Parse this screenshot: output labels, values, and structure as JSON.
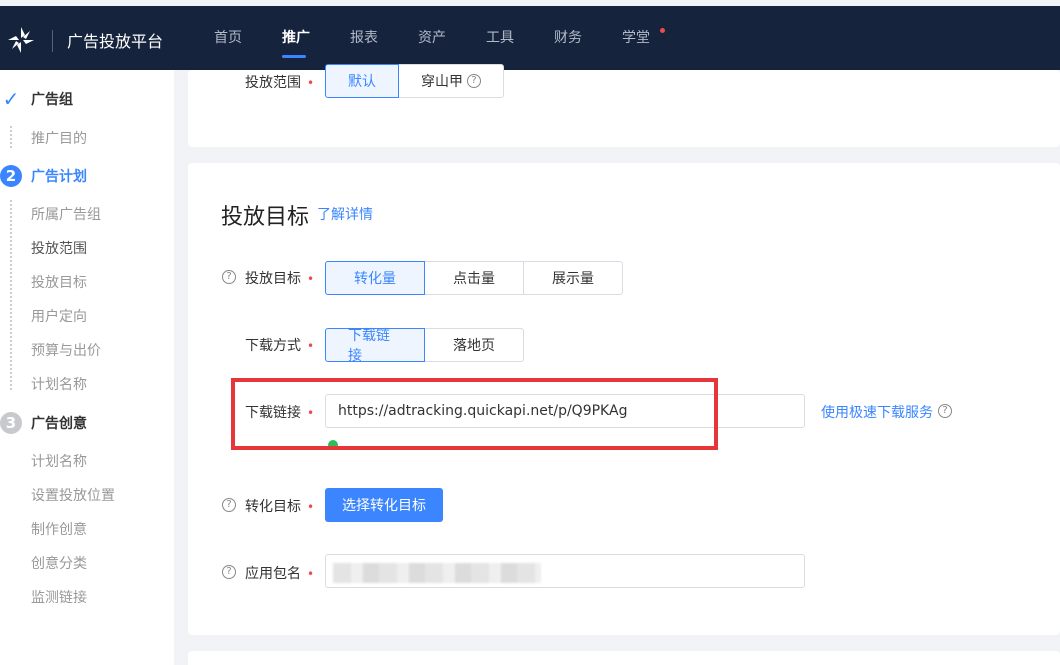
{
  "header": {
    "brand": "广告投放平台",
    "nav": [
      {
        "label": "首页",
        "active": false
      },
      {
        "label": "推广",
        "active": true
      },
      {
        "label": "报表",
        "active": false
      },
      {
        "label": "资产",
        "active": false
      },
      {
        "label": "工具",
        "active": false
      },
      {
        "label": "财务",
        "active": false
      },
      {
        "label": "学堂",
        "active": false,
        "dot": true
      }
    ]
  },
  "sidebar": {
    "steps": [
      {
        "icon": "check-icon",
        "marker": "✓",
        "label": "广告组",
        "state": "done",
        "items": [
          "推广目的"
        ]
      },
      {
        "marker": "2",
        "label": "广告计划",
        "state": "active",
        "items": [
          "所属广告组",
          "投放范围",
          "投放目标",
          "用户定向",
          "预算与出价",
          "计划名称"
        ]
      },
      {
        "marker": "3",
        "label": "广告创意",
        "state": "pending",
        "items": [
          "计划名称",
          "设置投放位置",
          "制作创意",
          "创意分类",
          "监测链接"
        ]
      }
    ]
  },
  "scope": {
    "label": "投放范围",
    "options": [
      "默认",
      "穿山甲"
    ],
    "selected": "默认"
  },
  "target_section": {
    "title": "投放目标",
    "detail_link": "了解详情",
    "goal_label": "投放目标",
    "goal_options": [
      "转化量",
      "点击量",
      "展示量"
    ],
    "goal_selected": "转化量",
    "download_method_label": "下载方式",
    "download_methods": [
      "下载链接",
      "落地页"
    ],
    "download_method_selected": "下载链接",
    "download_link_label": "下载链接",
    "download_link_value": "https://adtracking.quickapi.net/p/Q9PKAg",
    "fast_download_link": "使用极速下载服务",
    "conversion_label": "转化目标",
    "conversion_button": "选择转化目标",
    "package_label": "应用包名"
  },
  "colors": {
    "accent": "#3b86ff",
    "topbar": "#15233d",
    "highlight_box": "#e6363a",
    "status_ok": "#2fbd5a"
  }
}
